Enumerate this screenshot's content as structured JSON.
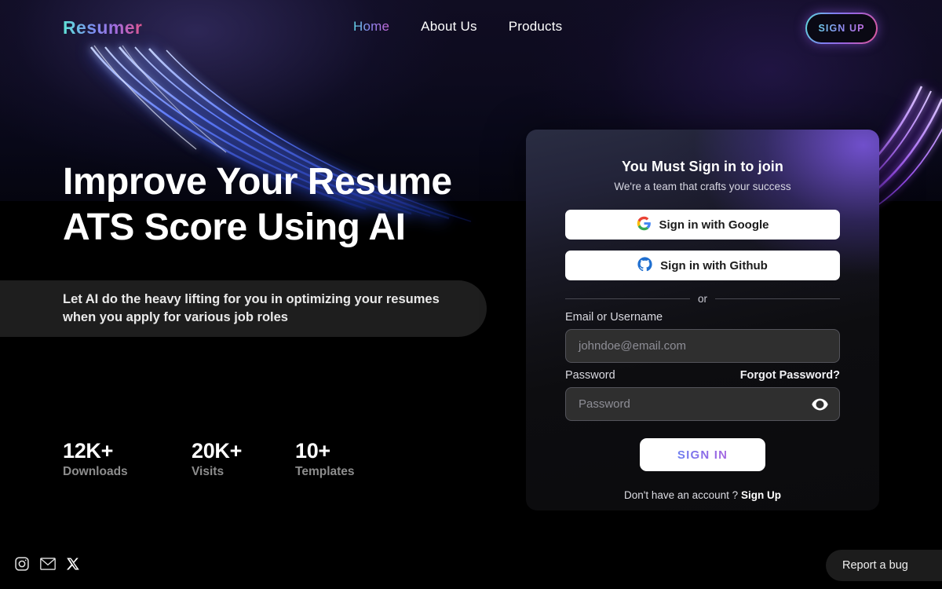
{
  "brand": {
    "name": "Resumer"
  },
  "nav": {
    "links": [
      {
        "label": "Home",
        "active": true
      },
      {
        "label": "About Us",
        "active": false
      },
      {
        "label": "Products",
        "active": false
      }
    ],
    "signup_label": "SIGN UP"
  },
  "hero": {
    "headline_line1": "Improve Your Resume",
    "headline_line2": "ATS Score Using AI",
    "subtitle": "Let AI do the heavy lifting for you in optimizing your resumes when you apply for various job roles",
    "stats": [
      {
        "value": "12K+",
        "label": "Downloads"
      },
      {
        "value": "20K+",
        "label": "Visits"
      },
      {
        "value": "10+",
        "label": "Templates"
      }
    ]
  },
  "signin": {
    "title": "You Must Sign in to join",
    "subtitle": "We're a team that crafts your success",
    "google_label": "Sign in with Google",
    "github_label": "Sign in with Github",
    "divider": "or",
    "email_label": "Email or Username",
    "email_placeholder": "johndoe@email.com",
    "password_label": "Password",
    "forgot_label": "Forgot Password?",
    "password_placeholder": "Password",
    "submit_label": "SIGN IN",
    "footer_text": "Don't have an account ?",
    "footer_link": "Sign Up"
  },
  "footer": {
    "socials": [
      {
        "name": "instagram-icon"
      },
      {
        "name": "email-icon"
      },
      {
        "name": "x-twitter-icon"
      }
    ],
    "report_bug_label": "Report a bug"
  },
  "colors": {
    "page_bg": "#000000",
    "hero_bg_top": "#100d22",
    "accent_cyan": "#5fe3d6",
    "accent_purple": "#8a6ae8",
    "accent_pink": "#e0568f",
    "card_purple_glow": "#7e58e6",
    "streak_blue": "#2f6bff",
    "streak_purple": "#8a3ff0",
    "subtitle_box": "#1e1e1e",
    "muted_text": "#8d8d8d"
  }
}
